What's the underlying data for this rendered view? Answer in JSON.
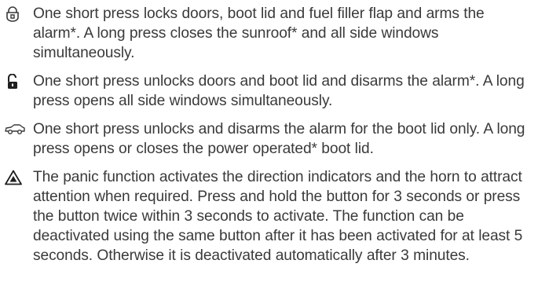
{
  "items": [
    {
      "icon": "lock-icon",
      "text": "One short press locks doors, boot lid and fuel filler flap and arms the alarm*. A long press closes the sunroof* and all side windows simultaneously."
    },
    {
      "icon": "unlock-icon",
      "text": "One short press unlocks doors and boot lid and disarms the alarm*. A long press opens all side windows simultaneously."
    },
    {
      "icon": "car-boot-icon",
      "text": "One short press unlocks and disarms the alarm for the boot lid only. A long press opens or closes the power operated* boot lid."
    },
    {
      "icon": "warning-triangle-icon",
      "text": "The panic function activates the direction indicators and the horn to attract attention when required. Press and hold the button for 3 seconds or press the button twice within 3 seconds to activate. The function can be deactivated using the same button after it has been activated for at least 5 seconds. Otherwise it is deactivated automatically after 3 minutes."
    }
  ]
}
